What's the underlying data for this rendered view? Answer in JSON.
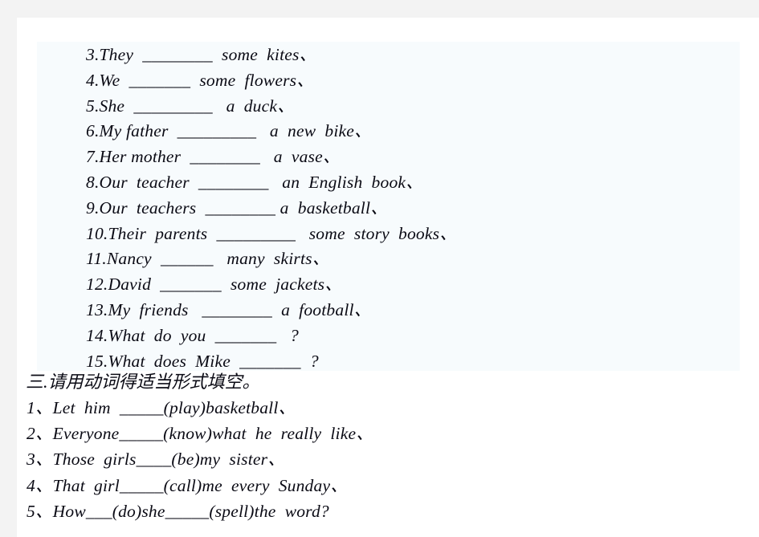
{
  "page": {
    "background_color": "#ffffff",
    "scan_strip_color": "#f3f3f3",
    "panel_color": "#f7fbfd",
    "text_color": "#0a0a14"
  },
  "exercise_block": {
    "lines": [
      "3.They  ________  some  kites、",
      "4.We  _______  some  flowers、",
      "5.She  _________   a  duck、",
      "6.My father  _________   a  new  bike、",
      "7.Her mother  ________   a  vase、",
      "8.Our  teacher  ________   an  English  book、",
      "9.Our  teachers  ________ a  basketball、",
      "10.Their  parents  _________   some  story  books、",
      "11.Nancy  ______   many  skirts、",
      "12.David  _______  some  jackets、",
      "13.My  friends   ________  a  football、",
      "14.What  do  you  _______   ?",
      "15.What  does  Mike  _______  ?"
    ]
  },
  "section_heading": {
    "text": "三.请用动词得适当形式填空。"
  },
  "fill_block": {
    "lines": [
      "1、Let  him  _____(play)basketball、",
      "2、Everyone_____(know)what  he  really  like、",
      "3、Those  girls____(be)my  sister、",
      "4、That  girl_____(call)me  every  Sunday、",
      "5、How___(do)she_____(spell)the  word?"
    ]
  }
}
